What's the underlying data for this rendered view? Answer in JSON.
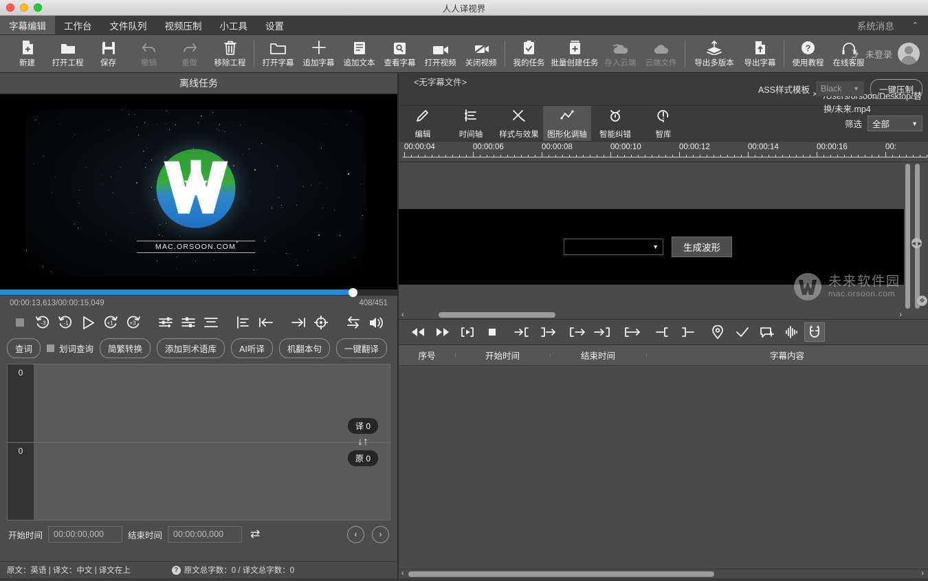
{
  "window": {
    "title": "人人译视界"
  },
  "menubar": {
    "items": [
      {
        "label": "字幕编辑",
        "active": true
      },
      {
        "label": "工作台",
        "active": false
      },
      {
        "label": "文件队列",
        "active": false
      },
      {
        "label": "视频压制",
        "active": false
      },
      {
        "label": "小工具",
        "active": false
      },
      {
        "label": "设置",
        "active": false
      }
    ],
    "system_message": "系统消息",
    "collapse_chevron": "⌃"
  },
  "toolbar": {
    "items": [
      {
        "label": "新建",
        "icon": "new-file-icon",
        "disabled": false
      },
      {
        "label": "打开工程",
        "icon": "open-folder-icon",
        "disabled": false
      },
      {
        "label": "保存",
        "icon": "save-disk-icon",
        "disabled": false
      },
      {
        "label": "撤销",
        "icon": "undo-icon",
        "disabled": true
      },
      {
        "label": "重做",
        "icon": "redo-icon",
        "disabled": true
      },
      {
        "label": "移除工程",
        "icon": "trash-icon",
        "disabled": false
      },
      {
        "label": "打开字幕",
        "icon": "folder-open-icon",
        "disabled": false
      },
      {
        "label": "追加字幕",
        "icon": "plus-icon",
        "disabled": false
      },
      {
        "label": "追加文本",
        "icon": "text-lines-icon",
        "disabled": false
      },
      {
        "label": "查看字幕",
        "icon": "search-box-icon",
        "disabled": false
      },
      {
        "label": "打开视频",
        "icon": "video-camera-icon",
        "disabled": false
      },
      {
        "label": "关闭视频",
        "icon": "video-camera-off-icon",
        "disabled": false
      },
      {
        "label": "我的任务",
        "icon": "clipboard-check-icon",
        "disabled": false
      },
      {
        "label": "批量创建任务",
        "icon": "clipboard-plus-icon",
        "disabled": false
      },
      {
        "label": "存入云端",
        "icon": "cloud-upload-icon",
        "disabled": true
      },
      {
        "label": "云端文件",
        "icon": "cloud-file-icon",
        "disabled": true
      },
      {
        "label": "导出多版本",
        "icon": "export-layers-icon",
        "disabled": false
      },
      {
        "label": "导出字幕",
        "icon": "export-file-icon",
        "disabled": false
      },
      {
        "label": "使用教程",
        "icon": "question-circle-icon",
        "disabled": false
      },
      {
        "label": "在线客服",
        "icon": "headset-icon",
        "disabled": false
      }
    ],
    "login_text": "未登录"
  },
  "left": {
    "offline_title": "离线任务",
    "video": {
      "logo_url_text": "MAC.ORSOON.COM"
    },
    "time_current": "00:00:13,613/00:00:15,049",
    "frame_counter": "408/451",
    "transport": [
      {
        "name": "stop-button",
        "glyph": "stop"
      },
      {
        "name": "back-3-button",
        "glyph": "-3"
      },
      {
        "name": "back-1-button",
        "glyph": "-1"
      },
      {
        "name": "play-button",
        "glyph": "play"
      },
      {
        "name": "forward-1-button",
        "glyph": "+1"
      },
      {
        "name": "forward-3-button",
        "glyph": "+3"
      },
      {
        "name": "adjust-sliders-button",
        "glyph": "sliders"
      },
      {
        "name": "align-center-button",
        "glyph": "align-mid"
      },
      {
        "name": "align-bottom-button",
        "glyph": "align-bottom"
      },
      {
        "name": "align-left-button",
        "glyph": "align-left"
      },
      {
        "name": "set-in-point-button",
        "glyph": "in"
      },
      {
        "name": "set-out-point-button",
        "glyph": "out"
      },
      {
        "name": "target-button",
        "glyph": "target"
      },
      {
        "name": "swap-button",
        "glyph": "swap"
      },
      {
        "name": "volume-button",
        "glyph": "volume"
      }
    ],
    "action_buttons": [
      {
        "label": "查词",
        "type": "pill"
      },
      {
        "label": "划词查询",
        "type": "checkbox"
      },
      {
        "label": "简繁转换",
        "type": "pill"
      },
      {
        "label": "添加到术语库",
        "type": "pill"
      },
      {
        "label": "AI听译",
        "type": "pill"
      },
      {
        "label": "机翻本句",
        "type": "pill"
      },
      {
        "label": "一键翻译",
        "type": "pill"
      }
    ],
    "editor": {
      "translation_gutter": "0",
      "original_gutter": "0",
      "translation_tag": "译 0",
      "original_tag": "原 0",
      "swap_icon": "↓↑",
      "translation_text": "",
      "original_text": ""
    },
    "time_fields": {
      "start_label": "开始时间",
      "start_value": "00:00:00,000",
      "end_label": "结束时间",
      "end_value": "00:00:00,000",
      "swap_icon": "⇄",
      "prev_icon": "‹",
      "next_icon": "›"
    },
    "status_bar": {
      "languages": "原文：英语 | 译文：中文 | 译文在上",
      "help_icon": "?",
      "counts": "原文总字数：0 / 译文总字数：0"
    }
  },
  "right": {
    "subtitle_file": "<无字幕文件>",
    "video_path": "/Users/orsoon/Desktop/替换/未来.mp4",
    "close_icon": "×",
    "ass_template_label": "ASS样式模板",
    "ass_template_value": "Black",
    "one_click_compress": "一键压制",
    "tabs": [
      {
        "label": "编辑",
        "icon": "pencil-icon",
        "active": false
      },
      {
        "label": "时间轴",
        "icon": "timeline-icon",
        "active": false
      },
      {
        "label": "样式与效果",
        "icon": "effects-icon",
        "active": false
      },
      {
        "label": "图形化调轴",
        "icon": "graph-adjust-icon",
        "active": true
      },
      {
        "label": "智能纠错",
        "icon": "smart-fix-icon",
        "active": false
      },
      {
        "label": "智库",
        "icon": "knowledge-icon",
        "active": false
      }
    ],
    "filter_label": "筛选",
    "filter_value": "全部",
    "ruler_ticks": [
      "00:00:04",
      "00:00:06",
      "00:00:08",
      "00:00:10",
      "00:00:12",
      "00:00:14",
      "00:00:16",
      "00:"
    ],
    "waveform": {
      "track_select_value": "",
      "generate_button": "生成波形"
    },
    "watermark": {
      "line1": "未来软件园",
      "line2": "mac.orsoon.com"
    },
    "transport": [
      {
        "name": "rewind-button",
        "glyph": "rewind"
      },
      {
        "name": "fast-forward-button",
        "glyph": "ff"
      },
      {
        "name": "play-segment-button",
        "glyph": "playseg"
      },
      {
        "name": "stop-button",
        "glyph": "stop"
      },
      {
        "name": "move-to-in-button",
        "glyph": "to-in"
      },
      {
        "name": "move-from-out-button",
        "glyph": "from-out"
      },
      {
        "name": "shift-in-button",
        "glyph": "shift-in"
      },
      {
        "name": "shift-out-button",
        "glyph": "shift-out"
      },
      {
        "name": "extend-button",
        "glyph": "extend"
      },
      {
        "name": "trim-start-button",
        "glyph": "trim-start"
      },
      {
        "name": "trim-end-button",
        "glyph": "trim-end"
      },
      {
        "name": "marker-button",
        "glyph": "marker"
      },
      {
        "name": "confirm-button",
        "glyph": "check"
      },
      {
        "name": "comment-button",
        "glyph": "comment"
      },
      {
        "name": "waveform-button",
        "glyph": "wave"
      },
      {
        "name": "magnet-snap-button",
        "glyph": "magnet"
      }
    ],
    "table": {
      "columns": [
        "序号",
        "开始时间",
        "结束时间",
        "字幕内容"
      ],
      "rows": []
    }
  }
}
